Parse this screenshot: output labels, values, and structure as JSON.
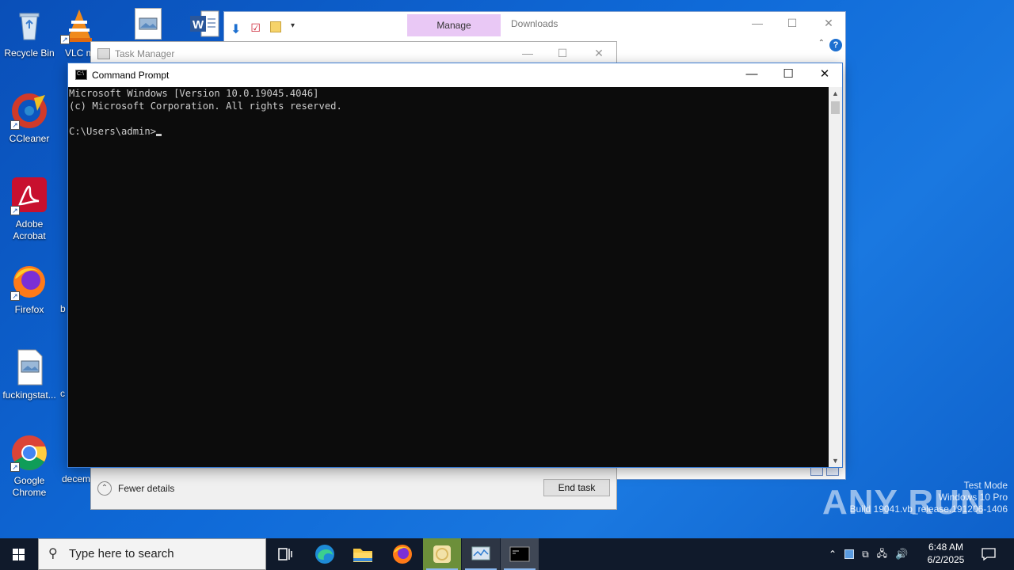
{
  "desktop": {
    "icons": [
      {
        "label": "Recycle Bin",
        "icon": "recycle-bin-icon"
      },
      {
        "label": "VLC m",
        "icon": "vlc-icon"
      },
      {
        "label": "CCleaner",
        "icon": "ccleaner-icon"
      },
      {
        "label": "Adobe\nAcrobat",
        "icon": "acrobat-icon"
      },
      {
        "label": "Firefox",
        "icon": "firefox-icon"
      },
      {
        "label": "b",
        "icon": "partial-icon"
      },
      {
        "label": "fuckingstat...",
        "icon": "image-file-icon"
      },
      {
        "label": "c",
        "icon": "partial-icon"
      },
      {
        "label": "Google\nChrome",
        "icon": "chrome-icon"
      },
      {
        "label": "decem",
        "icon": "partial-icon"
      }
    ]
  },
  "explorer": {
    "manage_tab": "Manage",
    "title": "Downloads",
    "help": "?"
  },
  "taskmgr": {
    "title": "Task Manager",
    "fewer_details": "Fewer details",
    "end_task": "End task"
  },
  "cmd": {
    "title": "Command Prompt",
    "line1": "Microsoft Windows [Version 10.0.19045.4046]",
    "line2": "(c) Microsoft Corporation. All rights reserved.",
    "prompt": "C:\\Users\\admin>"
  },
  "watermark": {
    "brand": "ANY RUN",
    "line1": "Test Mode",
    "line2": "Windows 10 Pro",
    "line3": "Build 19041.vb_release.191206-1406"
  },
  "taskbar": {
    "search_placeholder": "Type here to search",
    "time": "6:48 AM",
    "date": "6/2/2025"
  }
}
